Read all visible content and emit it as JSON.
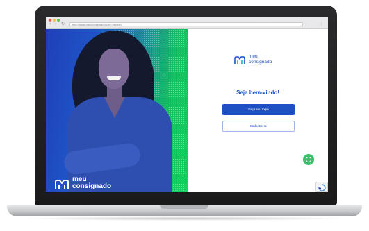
{
  "browser": {
    "url": "http://www.meuconsignado.com.br/login"
  },
  "promo": {
    "logo_text_line1": "meu",
    "logo_text_line2": "consignado"
  },
  "login": {
    "brand_line1": "meu",
    "brand_line2": "consignado",
    "welcome_text": "Seja bem-vindo!",
    "primary_button_label": "Faça seu login",
    "secondary_button_label": "Cadastre-se"
  },
  "colors": {
    "brand_blue": "#1f4fc2",
    "brand_green": "#12d25a",
    "whatsapp_green": "#3cbf6a"
  },
  "icons": {
    "chat": "whatsapp-icon",
    "captcha": "recaptcha-icon",
    "logo": "meu-consignado-logo-icon"
  }
}
